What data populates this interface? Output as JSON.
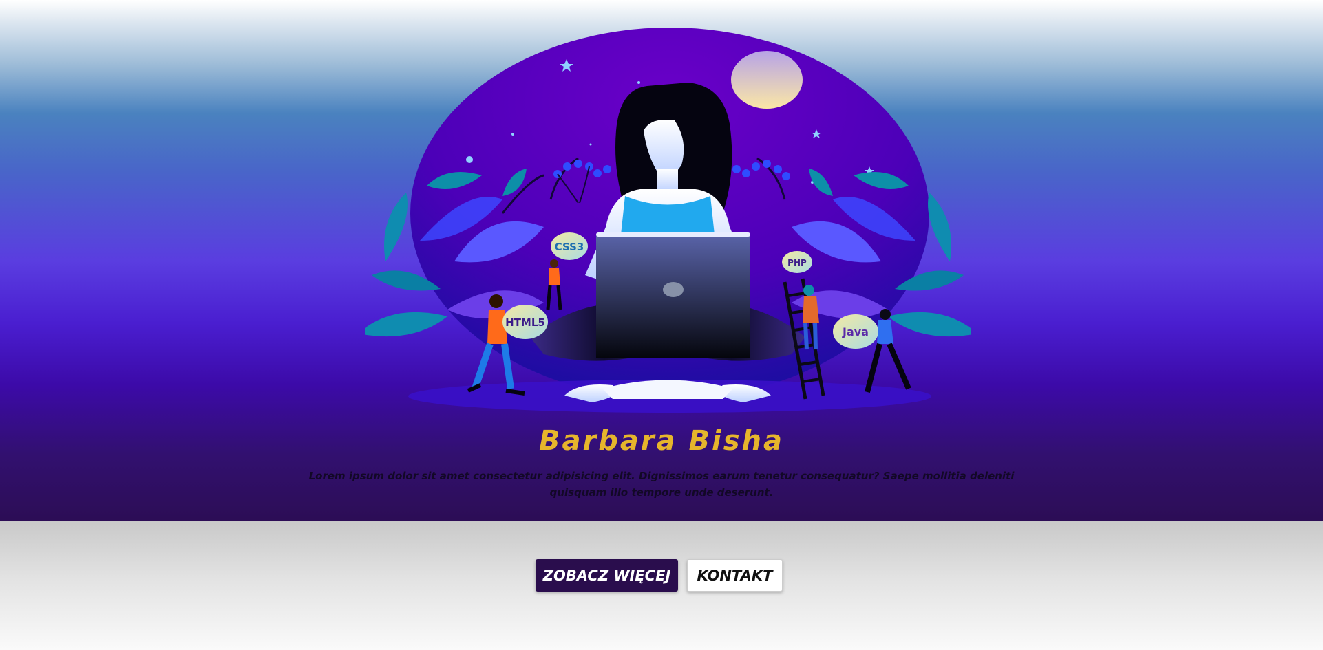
{
  "hero": {
    "name": "Barbara Bisha",
    "description": "Lorem ipsum dolor sit amet consectetur adipisicing elit. Dignissimos earum tenetur consequatur? Saepe mollitia deleniti quisquam illo tempore unde deserunt.",
    "skill_labels": [
      "CSS3",
      "HTML5",
      "PHP",
      "Java"
    ]
  },
  "actions": {
    "more_label": "ZOBACZ WIĘCEJ",
    "contact_label": "KONTAKT"
  },
  "colors": {
    "name_accent": "#e6b52c",
    "primary_button": "#2a0d4d",
    "secondary_button": "#ffffff"
  }
}
